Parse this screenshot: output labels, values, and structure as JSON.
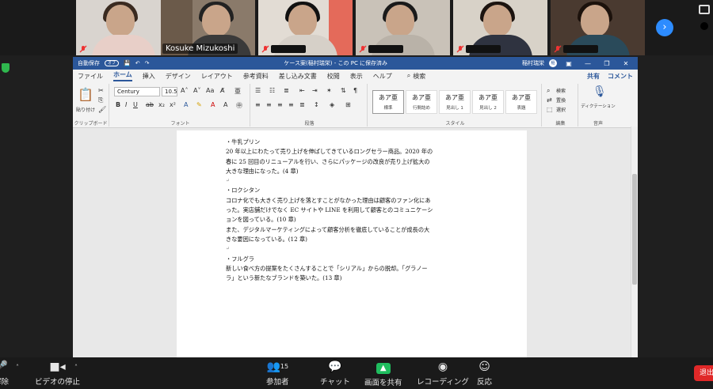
{
  "gallery": {
    "tiles": [
      {
        "name": ""
      },
      {
        "name": "Kosuke Mizukoshi"
      },
      {
        "name": ""
      },
      {
        "name": ""
      },
      {
        "name": ""
      },
      {
        "name": ""
      }
    ],
    "next_glyph": "›"
  },
  "word": {
    "titlebar": {
      "autosave": "自動保存",
      "toggle": "オフ",
      "doc_title": "ケース案(稲村瑞栄) - この PC に保存済み",
      "user": "稲村瑞栄",
      "minimize": "—",
      "restore": "❐",
      "close": "✕"
    },
    "tabs": [
      "ファイル",
      "ホーム",
      "挿入",
      "デザイン",
      "レイアウト",
      "参考資料",
      "差し込み文書",
      "校閲",
      "表示",
      "ヘルプ"
    ],
    "search": "検索",
    "share": "共有",
    "comment": "コメント",
    "ribbon": {
      "paste": "貼り付け",
      "clipboard": "クリップボード",
      "font_name": "Century",
      "font_size": "10.5",
      "font_group": "フォント",
      "paragraph_group": "段落",
      "styles_group": "スタイル",
      "styles": [
        {
          "sample": "あア亜",
          "name": "標準"
        },
        {
          "sample": "あア亜",
          "name": "行間詰め"
        },
        {
          "sample": "あア亜",
          "name": "見出し 1"
        },
        {
          "sample": "あア亜",
          "name": "見出し 2"
        },
        {
          "sample": "あア亜",
          "name": "表題"
        }
      ],
      "find": "検索",
      "replace": "置換",
      "select": "選択",
      "editing_group": "編集",
      "dictate": "ディクテーション",
      "voice_group": "音声"
    },
    "document": {
      "lines": [
        "・牛乳プリン",
        "20 年以上にわたって売り上げを伸ばしてきているロングセラー商品。2020 年の",
        "春に 25 回目のリニューアルを行い、さらにパッケージの改良が売り上げ拡大の",
        "大きな理由になった。(4 章)",
        "",
        "・ロクシタン",
        "コロナ化でも大きく売り上げを落とすことがなかった理由は顧客のファン化にあ",
        "った。実店舗だけでなく EC サイトや LINE を利用して顧客とのコミュニケーシ",
        "ョンを図っている。(10 章)",
        "また、デジタルマーケティングによって顧客分析を徹底していることが成長の大",
        "きな要因になっている。(12 章)",
        "",
        "・フルグラ",
        "新しい食べ方の提案をたくさんすることで「シリアル」からの脱却。「グラノー",
        "ラ」という新たなブランドを築いた。(13 章)"
      ]
    }
  },
  "toolbar": {
    "unmute": "解除",
    "stop_video": "ビデオの停止",
    "participants": "参加者",
    "participants_count": "15",
    "chat": "チャット",
    "share_screen": "画面を共有",
    "recording": "レコーディング",
    "reactions": "反応",
    "end": "退出"
  },
  "colors": {
    "word_blue": "#2b579a",
    "zoom_blue": "#2d8cff",
    "share_green": "#1fbd5e",
    "end_red": "#e02828"
  }
}
